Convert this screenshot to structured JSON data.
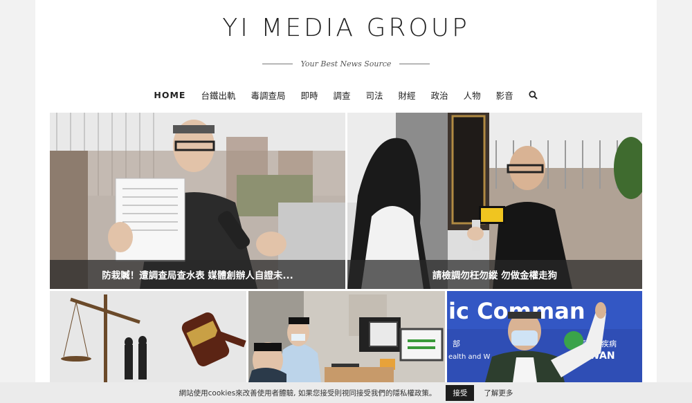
{
  "header": {
    "site_title": "YI MEDIA GROUP",
    "tagline": "Your Best News Source"
  },
  "nav": {
    "items": [
      {
        "label": "HOME",
        "active": true
      },
      {
        "label": "台鐵出軌"
      },
      {
        "label": "毒調查局"
      },
      {
        "label": "即時"
      },
      {
        "label": "調查"
      },
      {
        "label": "司法"
      },
      {
        "label": "財經"
      },
      {
        "label": "政治"
      },
      {
        "label": "人物"
      },
      {
        "label": "影音"
      }
    ],
    "search_icon": "search-icon"
  },
  "featured": [
    {
      "caption": "防栽贓！遭調查局查水表 媒體創辦人自證未..."
    },
    {
      "caption": "請檢調勿枉勿縱 勿做金權走狗"
    }
  ],
  "grid": [
    {
      "image": "scales-of-justice-and-gavel"
    },
    {
      "image": "office-workers-at-computers"
    },
    {
      "image": "official-at-press-conference"
    }
  ],
  "cookie_bar": {
    "text": "網站使用cookies來改善使用者體驗, 如果您接受則視同接受我們的隱私權政策。",
    "accept_label": "接受",
    "more_label": "了解更多"
  }
}
